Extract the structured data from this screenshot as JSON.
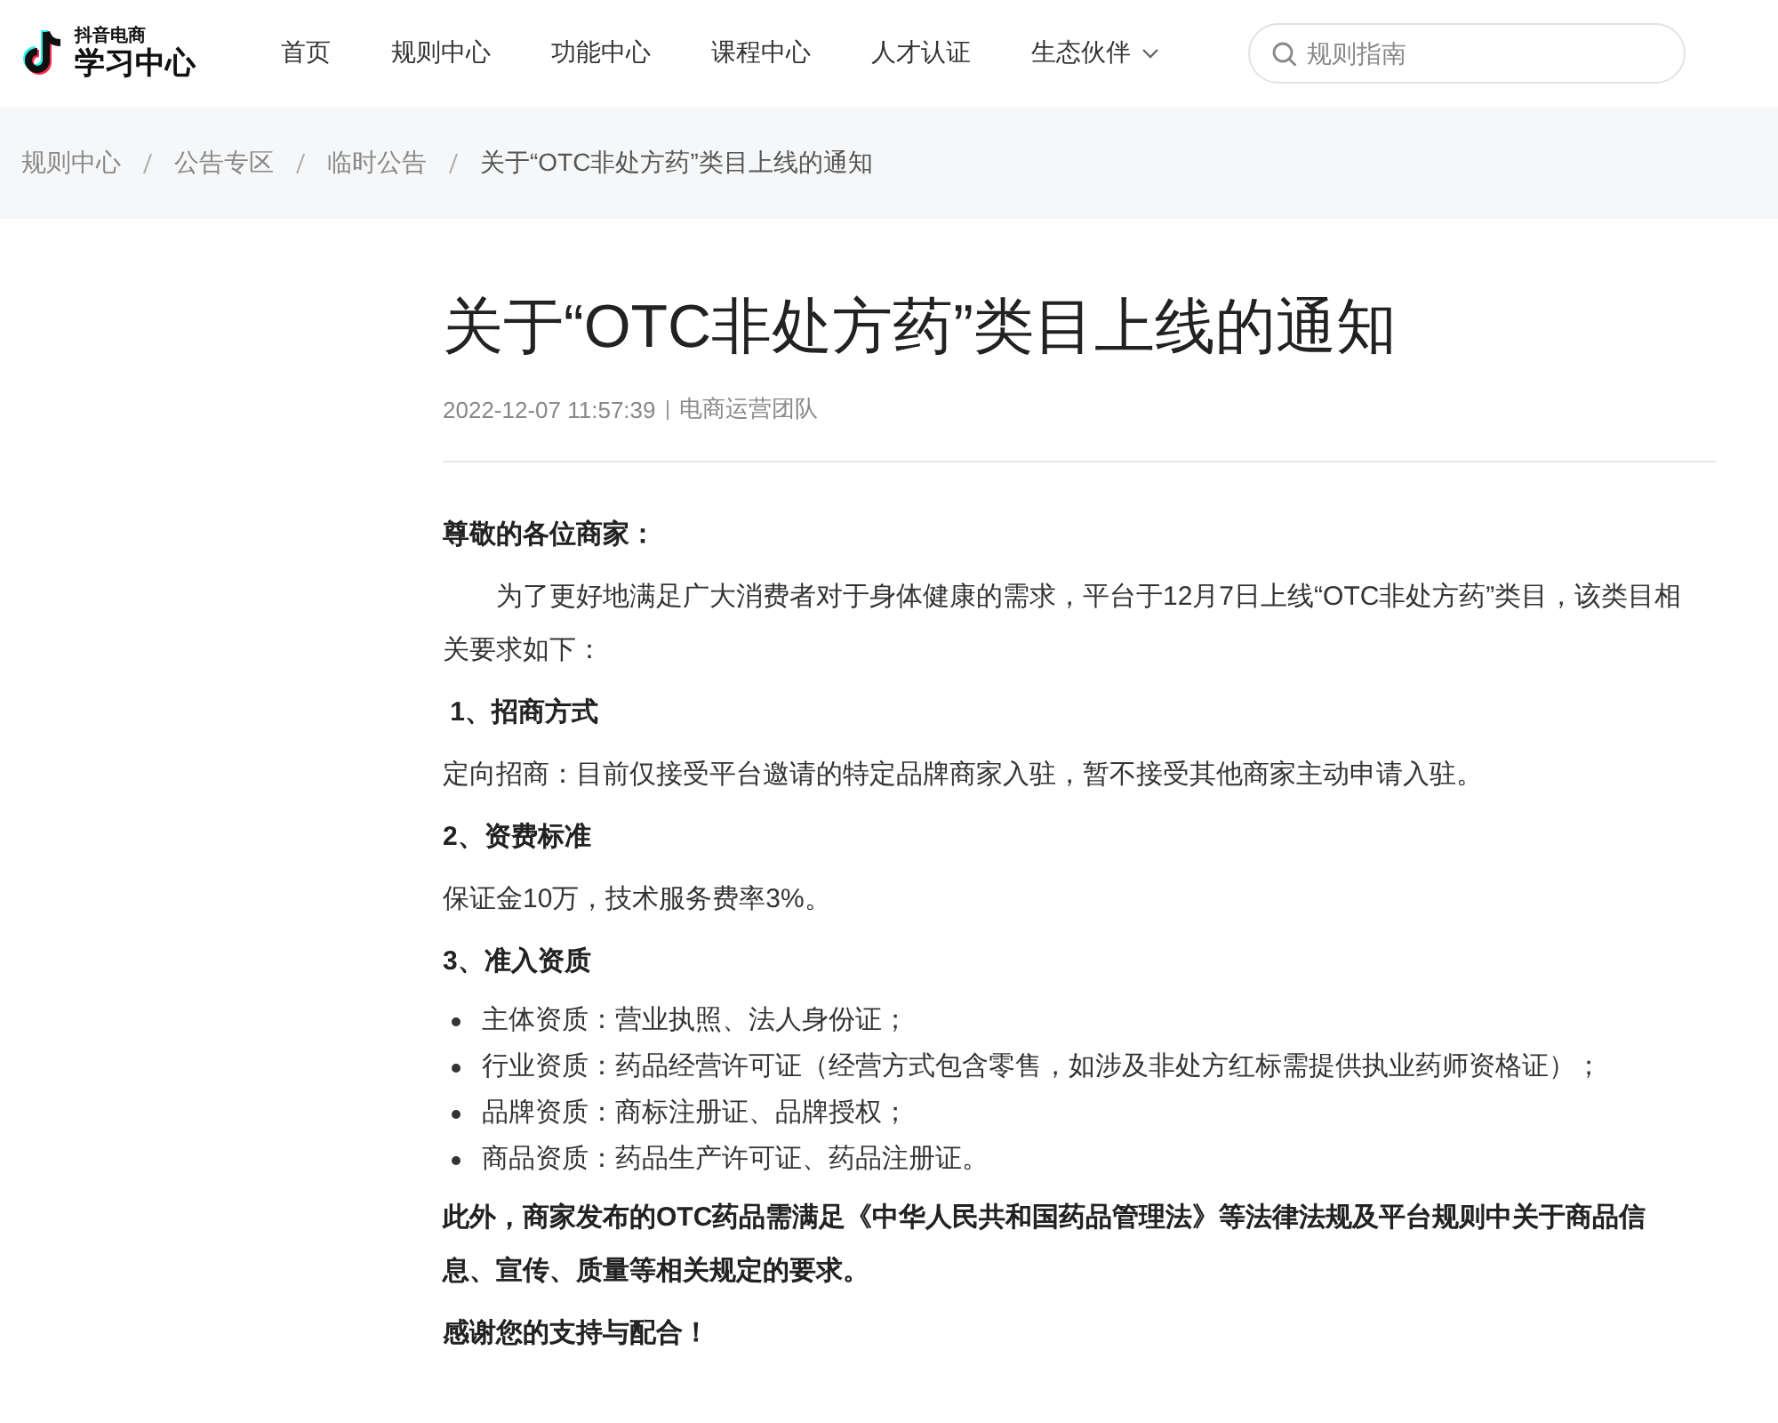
{
  "header": {
    "logo": {
      "small": "抖音电商",
      "main": "学习中心"
    },
    "nav": [
      {
        "label": "首页",
        "kind": "link"
      },
      {
        "label": "规则中心",
        "kind": "link"
      },
      {
        "label": "功能中心",
        "kind": "link"
      },
      {
        "label": "课程中心",
        "kind": "link"
      },
      {
        "label": "人才认证",
        "kind": "link"
      },
      {
        "label": "生态伙伴",
        "kind": "dropdown"
      }
    ],
    "search": {
      "placeholder": "规则指南"
    }
  },
  "breadcrumb": [
    "规则中心",
    "公告专区",
    "临时公告",
    "关于“OTC非处方药”类目上线的通知"
  ],
  "article": {
    "title": "关于“OTC非处方药”类目上线的通知",
    "date": "2022-12-07 11:57:39",
    "author": "电商运营团队",
    "blocks": [
      {
        "kind": "bold",
        "text": "尊敬的各位商家："
      },
      {
        "kind": "indent",
        "text": "为了更好地满足广大消费者对于身体健康的需求，平台于12月7日上线“OTC非处方药”类目，该类目相关要求如下："
      },
      {
        "kind": "heading",
        "text": " 1、招商方式"
      },
      {
        "kind": "text",
        "text": "定向招商：目前仅接受平台邀请的特定品牌商家入驻，暂不接受其他商家主动申请入驻。"
      },
      {
        "kind": "heading",
        "text": "2、资费标准"
      },
      {
        "kind": "text",
        "text": "保证金10万，技术服务费率3%。"
      },
      {
        "kind": "heading",
        "text": "3、准入资质"
      },
      {
        "kind": "list",
        "items": [
          "主体资质：营业执照、法人身份证；",
          "行业资质：药品经营许可证（经营方式包含零售，如涉及非处方红标需提供执业药师资格证）；",
          "品牌资质：商标注册证、品牌授权；",
          "商品资质：药品生产许可证、药品注册证。"
        ]
      },
      {
        "kind": "bold",
        "text": "此外，商家发布的OTC药品需满足《中华人民共和国药品管理法》等法律法规及平台规则中关于商品信息、宣传、质量等相关规定的要求。"
      },
      {
        "kind": "bold",
        "text": "感谢您的支持与配合！"
      }
    ]
  }
}
